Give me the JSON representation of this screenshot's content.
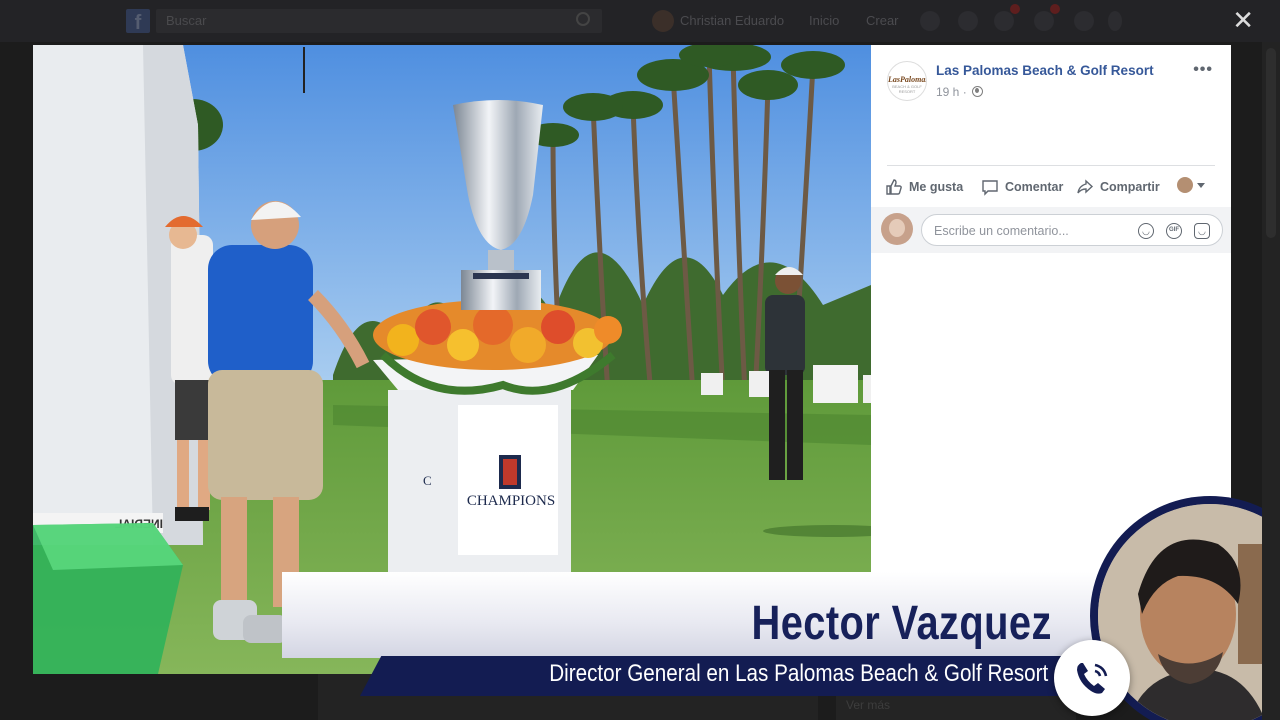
{
  "topbar": {
    "search_placeholder": "Buscar",
    "user_name": "Christian Eduardo",
    "nav_home": "Inicio",
    "nav_create": "Crear",
    "close_label": "✕"
  },
  "post": {
    "page_name": "Las Palomas Beach & Golf Resort",
    "avatar_logo": "LasPalomas",
    "avatar_sub": "BEACH & GOLF RESORT",
    "time": "19 h",
    "more": "•••",
    "actions": {
      "like": "Me gusta",
      "comment": "Comentar",
      "share": "Compartir"
    },
    "comment_placeholder": "Escribe un comentario...",
    "gif_label": "GIF"
  },
  "photo": {
    "pedestal_brand": "CHAMPIONS",
    "pedestal_side": "C",
    "tent_text": "INEDIAL"
  },
  "overlay": {
    "name": "Hector Vazquez",
    "role": "Director General en Las Palomas Beach & Golf Resort"
  },
  "background": {
    "partial_text": "Ver más"
  },
  "colors": {
    "fb_link": "#365899",
    "band_navy": "#131c52",
    "name_navy": "#17215a"
  }
}
